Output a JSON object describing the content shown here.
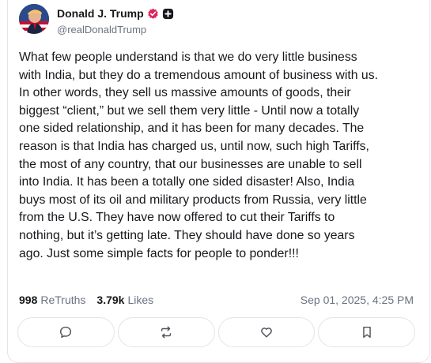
{
  "author": {
    "display_name": "Donald J. Trump",
    "handle": "@realDonaldTrump",
    "verified": true
  },
  "post": {
    "lines": [
      "What few people understand is that we do very little business",
      "with India, but they do a tremendous amount of business with us.",
      "In other words, they sell us massive amounts of goods, their",
      "biggest “client,” but we sell them very little - Until now a totally",
      "one sided relationship, and it has been for many decades. The",
      "reason is that India has charged us, until now, such high Tariffs,",
      "the most of any country, that our businesses are unable to sell",
      "into India. It has been a totally one sided disaster! Also, India",
      "buys most of its oil and military products from Russia, very little",
      "from the U.S. They have now offered to cut their Tariffs to",
      "nothing, but it’s getting late. They should have done so years",
      "ago. Just some simple facts for people to ponder!!!"
    ]
  },
  "stats": {
    "retruths_count": "998",
    "retruths_label": "ReTruths",
    "likes_count": "3.79k",
    "likes_label": "Likes",
    "timestamp": "Sep 01, 2025, 4:25 PM"
  },
  "actions": [
    {
      "icon": "comment-icon"
    },
    {
      "icon": "retruth-icon"
    },
    {
      "icon": "like-heart-icon"
    },
    {
      "icon": "bookmark-icon"
    }
  ],
  "colors": {
    "verified_badge": "#e0245e",
    "text_primary": "#17181c",
    "text_secondary": "#6b7280",
    "border": "#e4e4e7",
    "icon": "#52525b"
  }
}
